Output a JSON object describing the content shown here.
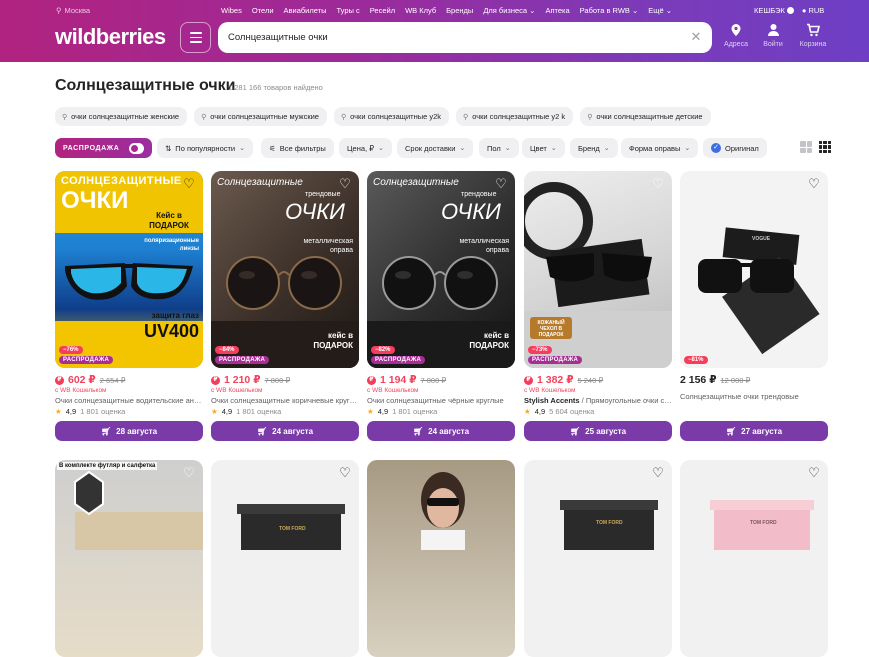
{
  "topbar": {
    "city": "Москва",
    "nav": [
      "Wibes",
      "Отели",
      "Авиабилеты",
      "Туры с",
      "Ресейл",
      "WB Клуб",
      "Бренды",
      "Для бизнеса",
      "Аптека",
      "Работа в RWB",
      "Ещё"
    ],
    "cashback": "КЕШБЭК",
    "currency": "RUB"
  },
  "header": {
    "logo": "wildberries",
    "search_value": "Солнцезащитные очки",
    "icons": [
      {
        "name": "location-icon",
        "label": "Адреса"
      },
      {
        "name": "user-icon",
        "label": "Войти"
      },
      {
        "name": "cart-icon",
        "label": "Корзина"
      }
    ]
  },
  "page": {
    "title": "Солнцезащитные очки",
    "count": "1 281 166 товаров найдено"
  },
  "query_chips": [
    "очки солнцезащитные женские",
    "очки солнцезащитные мужские",
    "очки солнцезащитные y2k",
    "очки солнцезащитные y2 k",
    "очки солнцезащитные детские"
  ],
  "filters": {
    "sale": "РАСПРОДАЖА",
    "sort": "По популярности",
    "all": "Все фильтры",
    "items": [
      "Цена, ₽",
      "Срок доставки",
      "Пол",
      "Цвет",
      "Бренд",
      "Форма оправы"
    ],
    "original": "Оригинал"
  },
  "colors": {
    "accent": "#7a3aa7",
    "price": "#f5425c",
    "header_start": "#b1237f",
    "header_end": "#6e3fc4"
  },
  "products": [
    {
      "price": "602 ₽",
      "old": "2 654 ₽",
      "wallet": "с WB Кошельком",
      "brand": "",
      "name": "Очки солнцезащитные водительские антибликовые",
      "rating": "4,9",
      "reviews": "1 801 оценка",
      "delivery": "28 августа",
      "discount": "−76%",
      "sale": "РАСПРОДАЖА",
      "wb": true,
      "poster": {
        "l1": "СОЛНЦЕЗАЩИТНЫЕ",
        "l2": "ОЧКИ",
        "l3": "Кейс в ПОДАРОК",
        "l4": "поляризационные линзы",
        "l5": "защита глаз",
        "l6": "UV400"
      }
    },
    {
      "price": "1 210 ₽",
      "old": "7 800 ₽",
      "wallet": "с WB Кошельком",
      "brand": "",
      "name": "Очки солнцезащитные коричневые круглые",
      "rating": "4,9",
      "reviews": "1 801 оценка",
      "delivery": "24 августа",
      "discount": "−84%",
      "sale": "РАСПРОДАЖА",
      "wb": true,
      "poster": {
        "l1": "Солнцезащитные",
        "l2": "трендовые",
        "l3": "ОЧКИ",
        "l4": "металлическая оправа",
        "l5": "кейс в ПОДАРОК"
      }
    },
    {
      "price": "1 194 ₽",
      "old": "7 000 ₽",
      "wallet": "с WB Кошельком",
      "brand": "",
      "name": "Очки солнцезащитные чёрные круглые",
      "rating": "4,9",
      "reviews": "1 801 оценка",
      "delivery": "24 августа",
      "discount": "−82%",
      "sale": "РАСПРОДАЖА",
      "wb": true,
      "poster": {
        "l1": "Солнцезащитные",
        "l2": "трендовые",
        "l3": "ОЧКИ",
        "l4": "металлическая оправа",
        "l5": "кейс в ПОДАРОК"
      }
    },
    {
      "price": "1 382 ₽",
      "old": "5 240 ₽",
      "wallet": "с WB Кошельком",
      "brand": "Stylish Accents",
      "name": " / Прямоугольные очки солнцезащитные",
      "rating": "4,9",
      "reviews": "5 604 оценка",
      "delivery": "25 августа",
      "discount": "−73%",
      "sale": "РАСПРОДАЖА",
      "wb": true,
      "poster": {
        "l1": "КОЖАНЫЙ ЧЕХОЛ В ПОДАРОК"
      }
    },
    {
      "price": "2 156 ₽",
      "old": "12 000 ₽",
      "wallet": "",
      "brand": "",
      "name": "Солнцезащитные очки трендовые",
      "rating": "",
      "reviews": "",
      "delivery": "27 августа",
      "discount": "−81%",
      "sale": "",
      "wb": false,
      "poster": {
        "l1": "VOGUE"
      }
    }
  ],
  "row2": [
    {
      "tag": "В комплекте футляр и салфетка"
    },
    {
      "tag": "TOM FORD"
    },
    {
      "tag": ""
    },
    {
      "tag": "TOM FORD"
    },
    {
      "tag": "TOM FORD"
    }
  ]
}
